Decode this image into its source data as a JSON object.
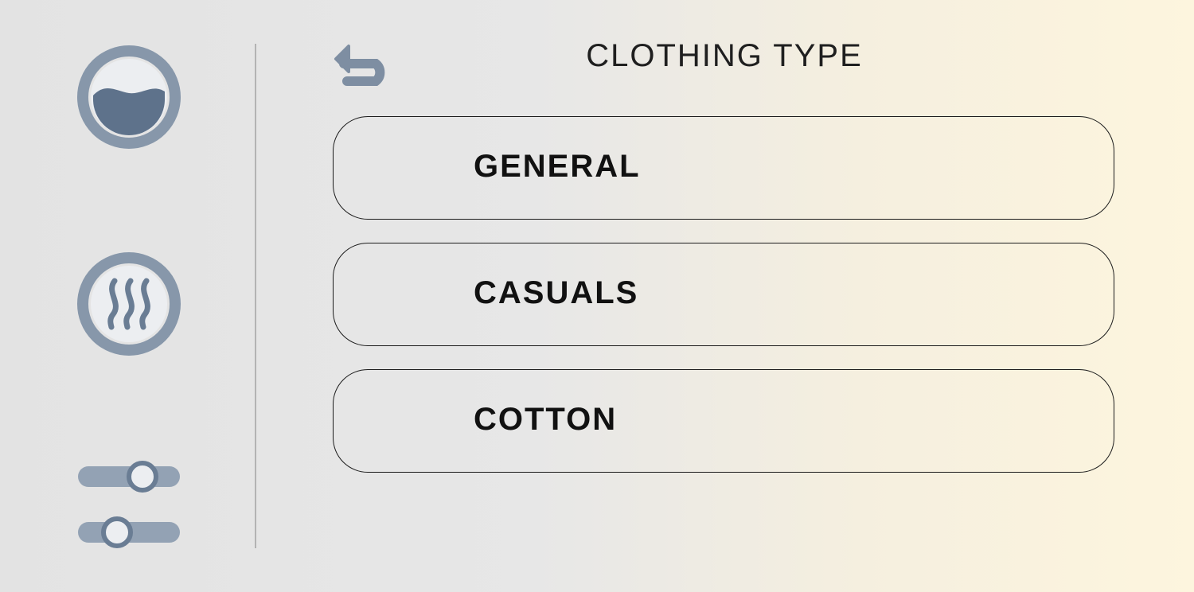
{
  "header": {
    "title": "CLOTHING TYPE",
    "back_icon": "back-arrow-icon"
  },
  "sidebar": {
    "items": [
      {
        "name": "wash",
        "icon": "water-drum-icon"
      },
      {
        "name": "steam",
        "icon": "steam-icon"
      },
      {
        "name": "settings",
        "icon": "sliders-icon"
      }
    ]
  },
  "options": [
    {
      "label": "GENERAL"
    },
    {
      "label": "CASUALS"
    },
    {
      "label": "COTTON"
    }
  ],
  "colors": {
    "icon": "#8494a7",
    "icon_dark": "#5e728b",
    "text": "#111111",
    "border": "#1c1c1c"
  }
}
